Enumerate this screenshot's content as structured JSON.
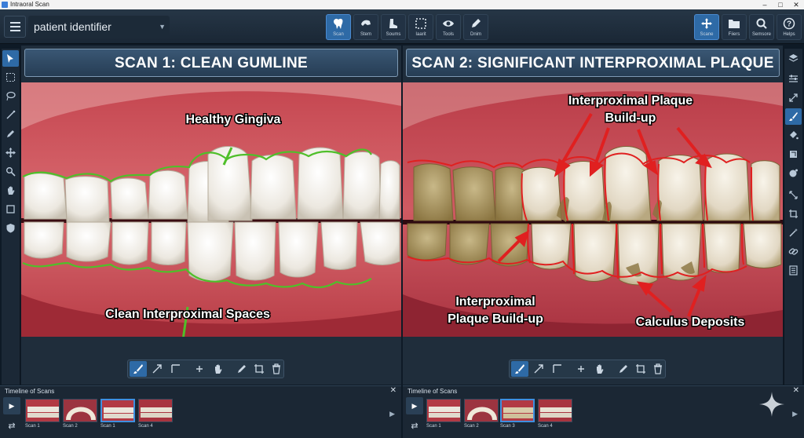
{
  "window": {
    "title": "Intraoral Scan",
    "min": "–",
    "max": "□",
    "close": "✕"
  },
  "toolbar": {
    "patient_placeholder": "patient identifier",
    "center_buttons": [
      {
        "label": "Scan",
        "icon": "tooth-icon",
        "active": true
      },
      {
        "label": "Stem",
        "icon": "stem-icon",
        "active": false
      },
      {
        "label": "Soums",
        "icon": "boot-icon",
        "active": false
      },
      {
        "label": "Iaarit",
        "icon": "select-frame-icon",
        "active": false
      },
      {
        "label": "Tools",
        "icon": "eye-icon",
        "active": false
      },
      {
        "label": "Dnim",
        "icon": "pen-icon",
        "active": false
      }
    ],
    "right_buttons": [
      {
        "label": "Scane",
        "icon": "move-icon",
        "active": true
      },
      {
        "label": "Fiiers",
        "icon": "folder-icon",
        "active": false
      },
      {
        "label": "Semsore",
        "icon": "search-icon",
        "active": false
      },
      {
        "label": "Helps",
        "icon": "help-icon",
        "active": false
      }
    ]
  },
  "panels": [
    {
      "title": "SCAN 1: CLEAN GUMLINE",
      "annotations": [
        "Healthy Gingiva",
        "Clean Interproximal Spaces"
      ]
    },
    {
      "title": "SCAN 2: SIGNIFICANT INTERPROXIMAL PLAQUE",
      "annotations": [
        "Interproximal Plaque",
        "Build-up",
        "Interproximal",
        "Plaque Build-up",
        "Calculus Deposits"
      ]
    }
  ],
  "timelines": [
    {
      "title": "Timeline of Scans",
      "close": "✕",
      "thumbnails": [
        {
          "label": "Scan 1",
          "active": false
        },
        {
          "label": "Scan 2",
          "active": false
        },
        {
          "label": "Scan 1",
          "active": true
        },
        {
          "label": "Scan 4",
          "active": false
        }
      ]
    },
    {
      "title": "Timeline of Scans",
      "close": "✕",
      "thumbnails": [
        {
          "label": "Scan 1",
          "active": false
        },
        {
          "label": "Scan 2",
          "active": false
        },
        {
          "label": "Scan 3",
          "active": true
        },
        {
          "label": "Scan 4",
          "active": false
        }
      ]
    }
  ],
  "colors": {
    "accent": "#2e6aa6",
    "healthy_outline": "#4fbf2a",
    "plaque_outline": "#e02020"
  }
}
